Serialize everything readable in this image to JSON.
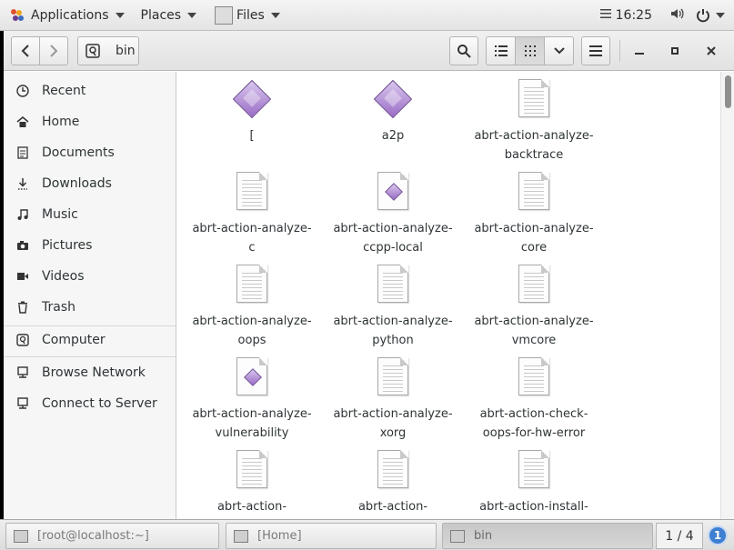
{
  "top_panel": {
    "applications_label": "Applications",
    "places_label": "Places",
    "files_label": "Files",
    "clock": "16:25"
  },
  "headerbar": {
    "path_label": "bin"
  },
  "sidebar": {
    "items": [
      {
        "label": "Recent",
        "icon": "clock-icon"
      },
      {
        "label": "Home",
        "icon": "home-icon"
      },
      {
        "label": "Documents",
        "icon": "document-icon"
      },
      {
        "label": "Downloads",
        "icon": "download-icon"
      },
      {
        "label": "Music",
        "icon": "music-icon"
      },
      {
        "label": "Pictures",
        "icon": "camera-icon"
      },
      {
        "label": "Videos",
        "icon": "video-icon"
      },
      {
        "label": "Trash",
        "icon": "trash-icon"
      },
      {
        "label": "Computer",
        "icon": "computer-icon"
      },
      {
        "label": "Browse Network",
        "icon": "network-icon"
      },
      {
        "label": "Connect to Server",
        "icon": "server-icon"
      }
    ]
  },
  "files": [
    {
      "name": "[",
      "kind": "exec"
    },
    {
      "name": "a2p",
      "kind": "exec"
    },
    {
      "name": "abrt-action-analyze-\nbacktrace",
      "kind": "text"
    },
    {
      "name": "abrt-action-analyze-\nc",
      "kind": "text"
    },
    {
      "name": "abrt-action-analyze-\nccpp-local",
      "kind": "script"
    },
    {
      "name": "abrt-action-analyze-\ncore",
      "kind": "text"
    },
    {
      "name": "abrt-action-analyze-\noops",
      "kind": "text"
    },
    {
      "name": "abrt-action-analyze-\npython",
      "kind": "text"
    },
    {
      "name": "abrt-action-analyze-\nvmcore",
      "kind": "text"
    },
    {
      "name": "abrt-action-analyze-\nvulnerability",
      "kind": "script"
    },
    {
      "name": "abrt-action-analyze-\nxorg",
      "kind": "text"
    },
    {
      "name": "abrt-action-check-\noops-for-hw-error",
      "kind": "text"
    },
    {
      "name": "abrt-action-",
      "kind": "text"
    },
    {
      "name": "abrt-action-",
      "kind": "text"
    },
    {
      "name": "abrt-action-install-",
      "kind": "text"
    }
  ],
  "taskbar": {
    "tasks": [
      {
        "label": "[root@localhost:~]"
      },
      {
        "label": "[Home]"
      },
      {
        "label": "bin"
      }
    ],
    "workspace": "1 / 4",
    "notifications": "1"
  }
}
